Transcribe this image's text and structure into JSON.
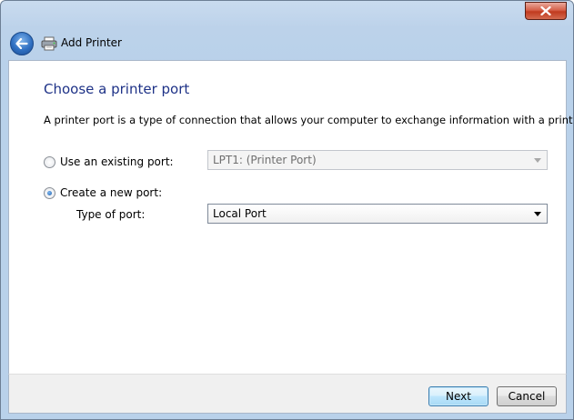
{
  "window": {
    "title": "Add Printer"
  },
  "header": {
    "wizard_title": "Add Printer"
  },
  "main": {
    "heading": "Choose a printer port",
    "description": "A printer port is a type of connection that allows your computer to exchange information with a printer.",
    "existing_port": {
      "label": "Use an existing port:",
      "selected": false,
      "value": "LPT1: (Printer Port)",
      "enabled": false
    },
    "new_port": {
      "label": "Create a new port:",
      "selected": true,
      "type_label": "Type of port:",
      "value": "Local Port"
    }
  },
  "footer": {
    "next_label": "Next",
    "cancel_label": "Cancel"
  },
  "icons": {
    "back": "back-arrow-icon",
    "printer": "printer-icon",
    "close": "close-icon",
    "dropdown": "chevron-down-icon"
  }
}
